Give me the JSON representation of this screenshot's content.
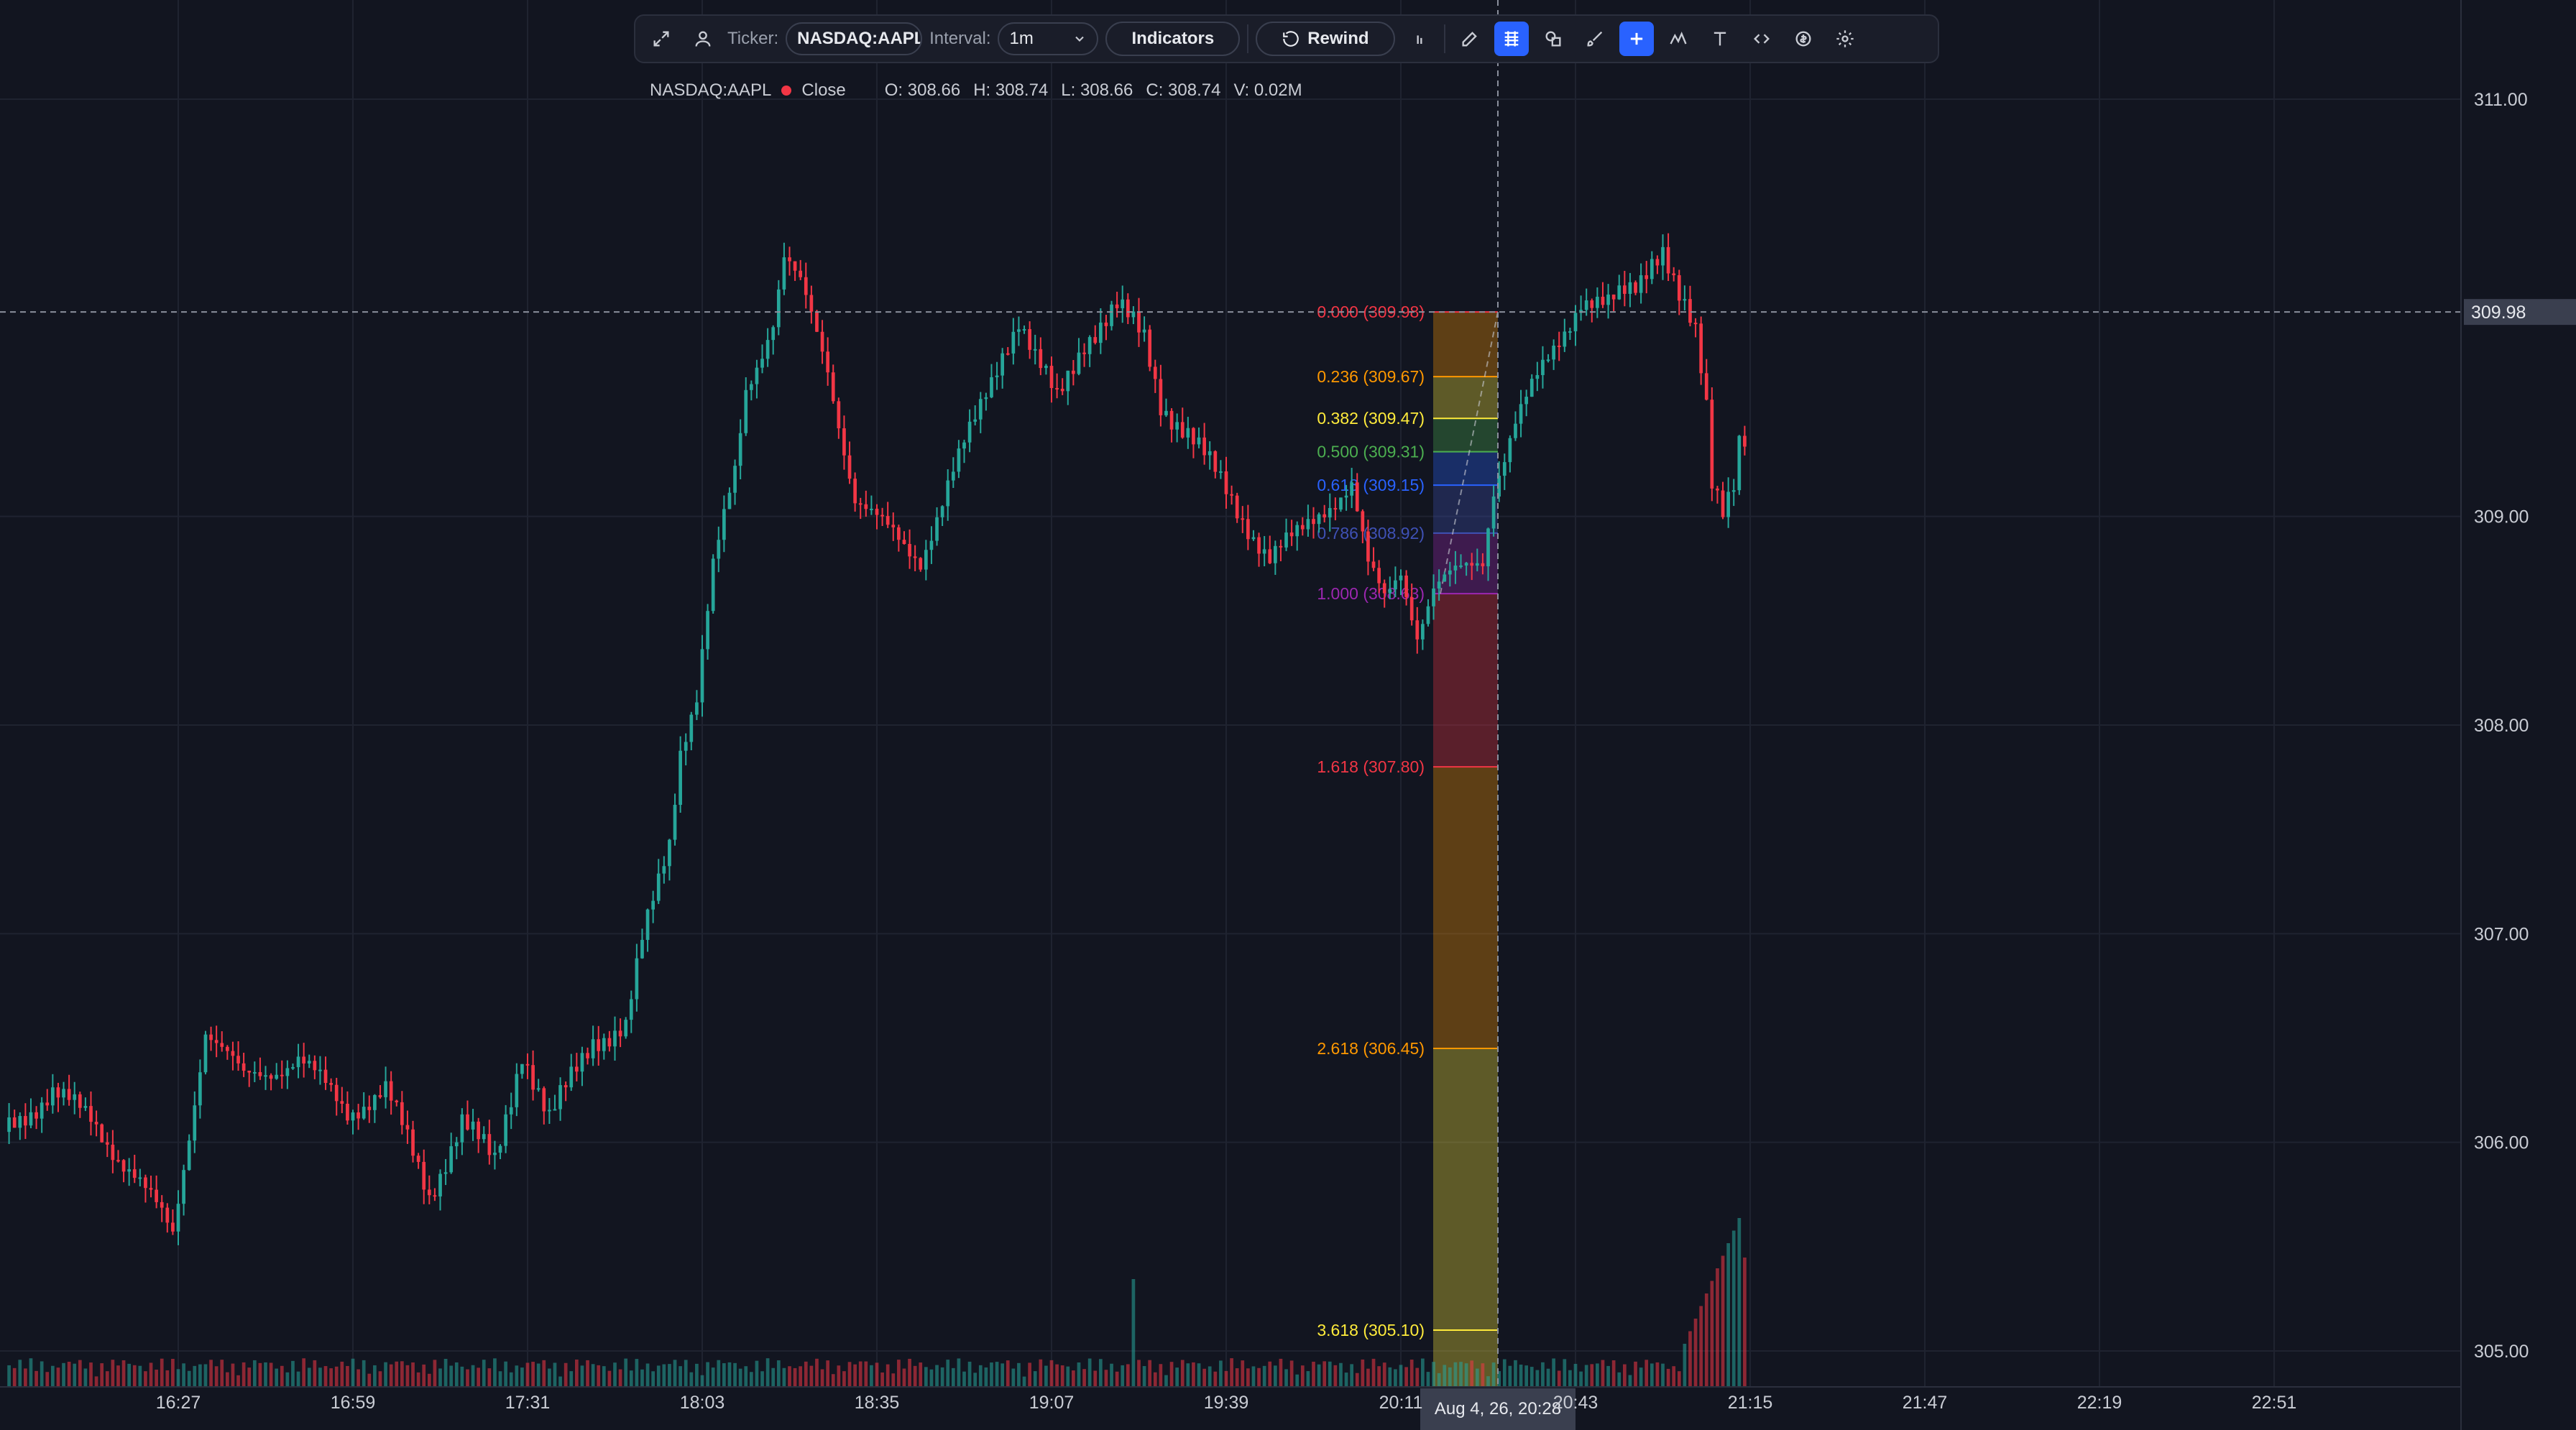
{
  "toolbar": {
    "ticker_label": "Ticker:",
    "ticker_value": "NASDAQ:AAPL",
    "interval_label": "Interval:",
    "interval_value": "1m",
    "indicators_label": "Indicators",
    "rewind_label": "Rewind"
  },
  "legend": {
    "symbol": "NASDAQ:AAPL",
    "series": "Close",
    "open": "O: 308.66",
    "high": "H: 308.74",
    "low": "L: 308.66",
    "close": "C: 308.74",
    "volume": "V: 0.02M"
  },
  "crosshair": {
    "price_label": "309.98",
    "time_label": "Aug 4, 26, 20:28"
  },
  "colors": {
    "background": "#121520",
    "up": "#26a69a",
    "down": "#f23645",
    "accent": "#2962ff"
  },
  "chart_data": {
    "type": "candlestick",
    "price_axis": [
      "311.00",
      "309.00",
      "308.00",
      "307.00",
      "306.00",
      "305.00"
    ],
    "price_ticks": [
      311,
      309,
      308,
      307,
      306,
      305
    ],
    "ylim": [
      304.8,
      311.3
    ],
    "time_axis": [
      "16:27",
      "16:59",
      "17:31",
      "18:03",
      "18:35",
      "19:07",
      "19:39",
      "20:11",
      "20:43",
      "21:15",
      "21:47",
      "22:19",
      "22:51"
    ],
    "close_path": [
      [
        "15:56",
        306.05
      ],
      [
        "16:05",
        306.25
      ],
      [
        "16:12",
        306.1
      ],
      [
        "16:20",
        305.85
      ],
      [
        "16:27",
        305.55
      ],
      [
        "16:33",
        306.55
      ],
      [
        "16:40",
        306.3
      ],
      [
        "16:50",
        306.4
      ],
      [
        "16:59",
        306.15
      ],
      [
        "17:06",
        306.25
      ],
      [
        "17:14",
        305.75
      ],
      [
        "17:20",
        306.1
      ],
      [
        "17:26",
        305.9
      ],
      [
        "17:31",
        306.45
      ],
      [
        "17:36",
        306.1
      ],
      [
        "17:44",
        306.5
      ],
      [
        "17:50",
        306.55
      ],
      [
        "17:53",
        306.95
      ],
      [
        "17:58",
        307.45
      ],
      [
        "18:00",
        307.9
      ],
      [
        "18:03",
        308.15
      ],
      [
        "18:06",
        308.75
      ],
      [
        "18:10",
        309.2
      ],
      [
        "18:12",
        309.6
      ],
      [
        "18:17",
        309.95
      ],
      [
        "18:19",
        310.25
      ],
      [
        "18:22",
        310.1
      ],
      [
        "18:27",
        309.7
      ],
      [
        "18:32",
        309.1
      ],
      [
        "18:37",
        308.95
      ],
      [
        "18:41",
        308.85
      ],
      [
        "18:44",
        308.8
      ],
      [
        "18:49",
        309.15
      ],
      [
        "18:54",
        309.45
      ],
      [
        "18:59",
        309.8
      ],
      [
        "19:02",
        309.95
      ],
      [
        "19:05",
        309.75
      ],
      [
        "19:09",
        309.55
      ],
      [
        "19:14",
        309.85
      ],
      [
        "19:18",
        309.95
      ],
      [
        "19:20",
        310.0
      ],
      [
        "19:25",
        309.85
      ],
      [
        "19:28",
        309.55
      ],
      [
        "19:33",
        309.4
      ],
      [
        "19:38",
        309.2
      ],
      [
        "19:43",
        309.0
      ],
      [
        "19:48",
        308.8
      ],
      [
        "19:53",
        308.9
      ],
      [
        "19:58",
        309.05
      ],
      [
        "20:03",
        309.15
      ],
      [
        "20:06",
        308.75
      ],
      [
        "20:09",
        308.6
      ],
      [
        "20:12",
        308.75
      ],
      [
        "20:15",
        308.45
      ],
      [
        "20:18",
        308.65
      ],
      [
        "20:21",
        308.7
      ],
      [
        "20:24",
        308.75
      ],
      [
        "20:27",
        308.8
      ],
      [
        "20:29",
        309.15
      ],
      [
        "20:31",
        309.3
      ],
      [
        "20:33",
        309.45
      ],
      [
        "20:36",
        309.6
      ],
      [
        "20:39",
        309.75
      ],
      [
        "20:42",
        309.9
      ],
      [
        "20:45",
        310.05
      ],
      [
        "20:50",
        310.0
      ],
      [
        "20:55",
        310.1
      ],
      [
        "20:58",
        310.25
      ],
      [
        "21:00",
        310.3
      ],
      [
        "21:03",
        310.05
      ],
      [
        "21:06",
        309.85
      ],
      [
        "21:08",
        309.5
      ],
      [
        "21:09",
        309.15
      ],
      [
        "21:11",
        309.05
      ],
      [
        "21:13",
        309.2
      ],
      [
        "21:14",
        309.4
      ]
    ],
    "fibonacci": {
      "levels": [
        {
          "label": "0.000 (309.98)",
          "price": 309.98,
          "color": "#f23645"
        },
        {
          "label": "0.236 (309.67)",
          "price": 309.67,
          "color": "#ff9800"
        },
        {
          "label": "0.382 (309.47)",
          "price": 309.47,
          "color": "#ffeb3b"
        },
        {
          "label": "0.500 (309.31)",
          "price": 309.31,
          "color": "#4caf50"
        },
        {
          "label": "0.618 (309.15)",
          "price": 309.15,
          "color": "#2962ff"
        },
        {
          "label": "0.786 (308.92)",
          "price": 308.92,
          "color": "#3f51b5"
        },
        {
          "label": "1.000 (308.63)",
          "price": 308.63,
          "color": "#9c27b0"
        },
        {
          "label": "1.618 (307.80)",
          "price": 307.8,
          "color": "#f23645"
        },
        {
          "label": "2.618 (306.45)",
          "price": 306.45,
          "color": "#ff9800"
        },
        {
          "label": "3.618 (305.10)",
          "price": 305.1,
          "color": "#ffeb3b"
        }
      ]
    },
    "last_volume_spike": 0.8
  }
}
